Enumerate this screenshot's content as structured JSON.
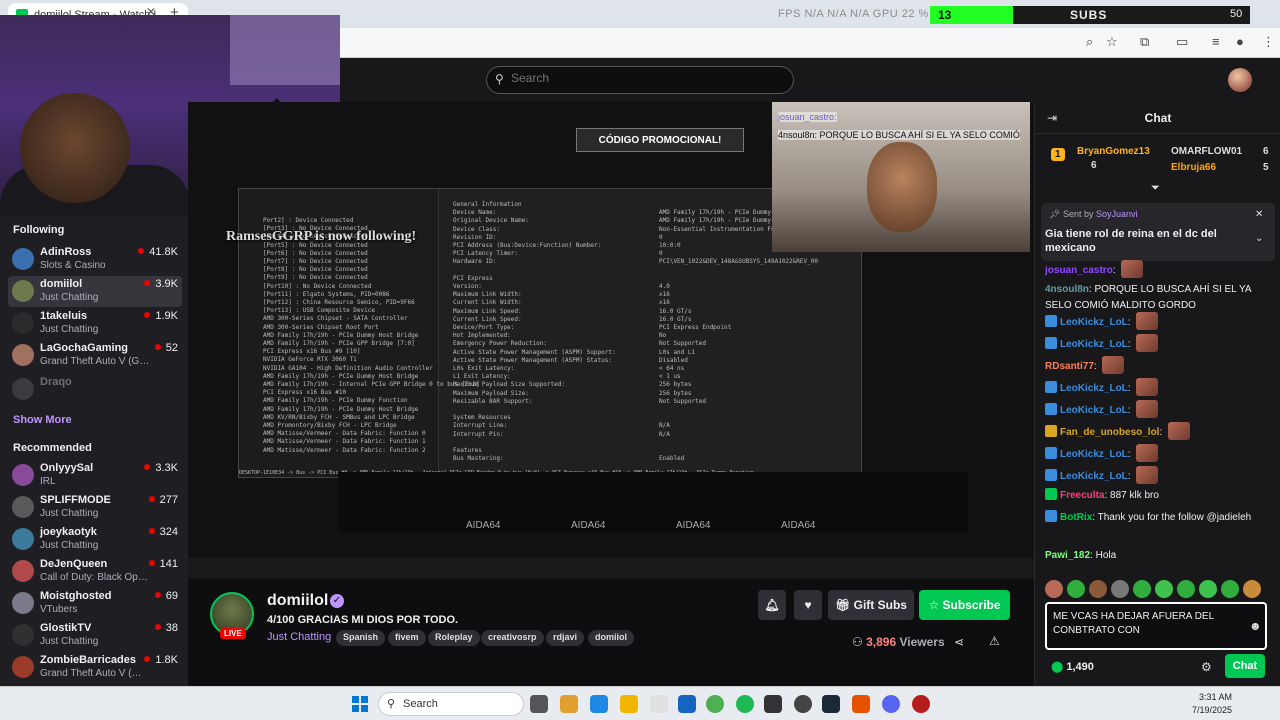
{
  "browser": {
    "tab_title": "domiilol Stream - Watch L",
    "tab_close": "✕",
    "new_tab": "+",
    "overlay_stats": "FPS N/A  N/A   N/A    GPU 22 % 41 °C",
    "sub_count": "13",
    "sub_label": "SUBS",
    "sub_goal": "50",
    "sub_fraction": 0.26
  },
  "nav": {
    "search_placeholder": "Search"
  },
  "stream_overlay": {
    "promo": "CÓDIGO PROMOCIONAL!",
    "follow_alert": "RamsesGGRP is now following!",
    "cam_msg_1": "josuan_castro:",
    "cam_msg_2": "4nsoul8n: PORQUE LO BUSCA AHÍ SI EL YA SELO COMIÓ",
    "aida_labels": [
      "AIDA64",
      "AIDA64",
      "AIDA64",
      "AIDA64"
    ],
    "aida_tree": "Port2] : Device Connected\n[Port3] : No Device Connected\n[Port4] : No Device Connected\n[Port5] : No Device Connected\n[Port6] : No Device Connected\n[Port7] : No Device Connected\n[Port8] : No Device Connected\n[Port9] : No Device Connected\n[Port10] : No Device Connected\n[Port11] : Elgato Systems, PID=0086\n[Port12] : China Resource Semico, PID=9F66\n[Port13] : USB Composite Device\nAMD 300-Series Chipset - SATA Controller\nAMD 300-Series Chipset Root Port\nAMD Family 17h/19h - PCIe Dummy Host Bridge\nAMD Family 17h/19h - PCIe GPP Bridge [7:0]\nPCI Express x16 Bus #9 [10]\nNVIDIA GeForce RTX 3060 Ti\nNVIDIA GA104 - High Definition Audio Controller\nAMD Family 17h/19h - PCIe Dummy Host Bridge\nAMD Family 17h/19h - Internal PCIe GPP Bridge 0 to bus [E:8]\nPCI Express x16 Bus #10\nAMD Family 17h/19h - PCIe Dummy Function\nAMD Family 17h/19h - PCIe Dummy Host Bridge\nAMD KV/RN/Bixby FCH - SMBus and LPC Bridge\nAMD Promontory/Bixby FCH - LPC Bridge\nAMD Matisse/Vermeer - Data Fabric: Function 0\nAMD Matisse/Vermeer - Data Fabric: Function 1\nAMD Matisse/Vermeer - Data Fabric: Function 2",
    "aida_fields": "General Information\nDevice Name:\nOriginal Device Name:\nDevice Class:\nRevision ID:\nPCI Address (Bus:Device:Function) Number:\nPCI Latency Timer:\nHardware ID:\n\nPCI Express\nVersion:\nMaximum Link Width:\nCurrent Link Width:\nMaximum Link Speed:\nCurrent Link Speed:\nDevice/Port Type:\nHot Implemented:\nEmergency Power Reduction:\nActive State Power Management (ASPM) Support:\nActive State Power Management (ASPM) Status:\nL0s Exit Latency:\nL1 Exit Latency:\nMaximum Payload Size Supported:\nMaximum Payload Size:\nResizable BAR Support:\n\nSystem Resources\nInterrupt Line:\nInterrupt Pin:\n\nFeatures\nBus Mastering:",
    "aida_values": "\nAMD Family 17h/19h - PCIe Dummy Function\nAMD Family 17h/19h - PCIe Dummy Function\nNon-Essential Instrumentation Function\n0\n10:0:0\n0\nPCI\\VEN_1022&DEV_148A&SUBSYS_148A1022&REV_00\n\n\n4.0\nx16\nx16\n16.0 GT/s\n16.0 GT/s\nPCI Express Endpoint\nNo\nNot Supported\nL0s and L1\nDisabled\n< 64 ns\n< 1 us\n256 bytes\n256 bytes\nNot Supported\n\n\nN/A\nN/A\n\n\nEnabled",
    "aida_status": "DESKTOP-1E10E34 -> Bus -> PCI Bus #0 -> AMD Family 17h/19h - Internal PCIe GPP Bridge 0 to bus [E:8] -> PCI Express x16 Bus #10 -> AMD Family 17h/19h - PCIe Dummy Function"
  },
  "sidebar": {
    "following_header": "Following",
    "following": [
      {
        "name": "AdinRoss",
        "game": "Slots & Casino",
        "viewers": "41.8K",
        "color": "#3a6fb0"
      },
      {
        "name": "domiilol",
        "game": "Just Chatting",
        "viewers": "3.9K",
        "color": "#6d7a4b"
      },
      {
        "name": "1takeluis",
        "game": "Just Chatting",
        "viewers": "1.9K",
        "color": "#2b2b2b"
      },
      {
        "name": "LaGochaGaming",
        "game": "Grand Theft Auto V (GTA)",
        "viewers": "52",
        "color": "#a07060"
      }
    ],
    "offline_name": "Draqo",
    "show_more": "Show More",
    "recommended_header": "Recommended",
    "recommended": [
      {
        "name": "OnlyyySal",
        "game": "IRL",
        "viewers": "3.3K",
        "color": "#8a4a9a"
      },
      {
        "name": "SPLIFFMODE",
        "game": "Just Chatting",
        "viewers": "277",
        "color": "#5a5a5a"
      },
      {
        "name": "joeykaotyk",
        "game": "Just Chatting",
        "viewers": "324",
        "color": "#3a7a9a"
      },
      {
        "name": "DeJenQueen",
        "game": "Call of Duty: Black Ops 6",
        "viewers": "141",
        "color": "#b04a4a"
      },
      {
        "name": "Moistghosted",
        "game": "VTubers",
        "viewers": "69",
        "color": "#7a7a8a"
      },
      {
        "name": "GlostikTV",
        "game": "Just Chatting",
        "viewers": "38",
        "color": "#303030"
      },
      {
        "name": "ZombieBarricades",
        "game": "Grand Theft Auto V (…",
        "viewers": "1.8K",
        "color": "#9a3a2a"
      }
    ]
  },
  "stream_info": {
    "channel": "domiilol",
    "live": "LIVE",
    "title": "4/100  GRACIAS MI DIOS POR TODO.",
    "category": "Just Chatting",
    "tags": [
      "Spanish",
      "fivem",
      "Roleplay",
      "creativosrp",
      "rdjavi",
      "domiiol"
    ],
    "gift_subs": "Gift Subs",
    "subscribe": "Subscribe",
    "viewers": "3,896",
    "viewers_label": "Viewers"
  },
  "chat": {
    "title": "Chat",
    "leaderboard": [
      {
        "rank": "1",
        "name": "BryanGomez13",
        "count": "6",
        "color": "#ffb31a"
      },
      {
        "rank": "",
        "name": "OMARFLOW01",
        "count": "6",
        "color": "#dedee3"
      },
      {
        "rank": "",
        "name": "Elbruja66",
        "count": "5",
        "color": "#ffa500"
      }
    ],
    "pinned_by_label": "Sent by",
    "pinned_by": "SoyJuanvi",
    "pinned_message": "Gia tiene rol de reina en el dc del mexicano",
    "messages": [
      {
        "user": "josuan_castro",
        "text": "",
        "color": "#9147ff",
        "emote": true,
        "badge": ""
      },
      {
        "user": "4nsoul8n",
        "text": "PORQUE LO BUSCA AHÍ SI EL YA SELO COMIÓ MALDITO GORDO",
        "color": "#5f9ea0",
        "emote": false,
        "badge": ""
      },
      {
        "user": "LeoKickz_LoL",
        "text": "",
        "color": "#3a8dde",
        "emote": true,
        "badge": "#3a8dde"
      },
      {
        "user": "LeoKickz_LoL",
        "text": "",
        "color": "#3a8dde",
        "emote": true,
        "badge": "#3a8dde"
      },
      {
        "user": "RDsanti77",
        "text": "",
        "color": "#ff7f50",
        "emote": true,
        "badge": ""
      },
      {
        "user": "LeoKickz_LoL",
        "text": "",
        "color": "#3a8dde",
        "emote": true,
        "badge": "#3a8dde"
      },
      {
        "user": "LeoKickz_LoL",
        "text": "",
        "color": "#3a8dde",
        "emote": true,
        "badge": "#3a8dde"
      },
      {
        "user": "Fan_de_unobeso_lol",
        "text": "",
        "color": "#daa520",
        "emote": true,
        "badge": "#daa520"
      },
      {
        "user": "LeoKickz_LoL",
        "text": "",
        "color": "#3a8dde",
        "emote": true,
        "badge": "#3a8dde"
      },
      {
        "user": "LeoKickz_LoL",
        "text": "",
        "color": "#3a8dde",
        "emote": true,
        "badge": "#3a8dde"
      },
      {
        "user": "Freeculta",
        "text": "887 klk bro",
        "color": "#ff3c82",
        "emote": false,
        "badge": "#00c853"
      },
      {
        "user": "BotRix",
        "text": "Thank you for the follow @jadieleh",
        "color": "#00c853",
        "emote": false,
        "badge": "#3a8dde"
      },
      {
        "user": "Pawi_182",
        "text": "Hola",
        "color": "#7fff7f",
        "emote": false,
        "badge": ""
      }
    ],
    "input_value": "ME VCAS HA DEJAR AFUERA DEL CONBTRATO CON",
    "points": "1,490",
    "chat_button": "Chat"
  },
  "taskbar": {
    "search_label": "Search",
    "time": "3:31 AM",
    "date": "7/19/2025"
  }
}
